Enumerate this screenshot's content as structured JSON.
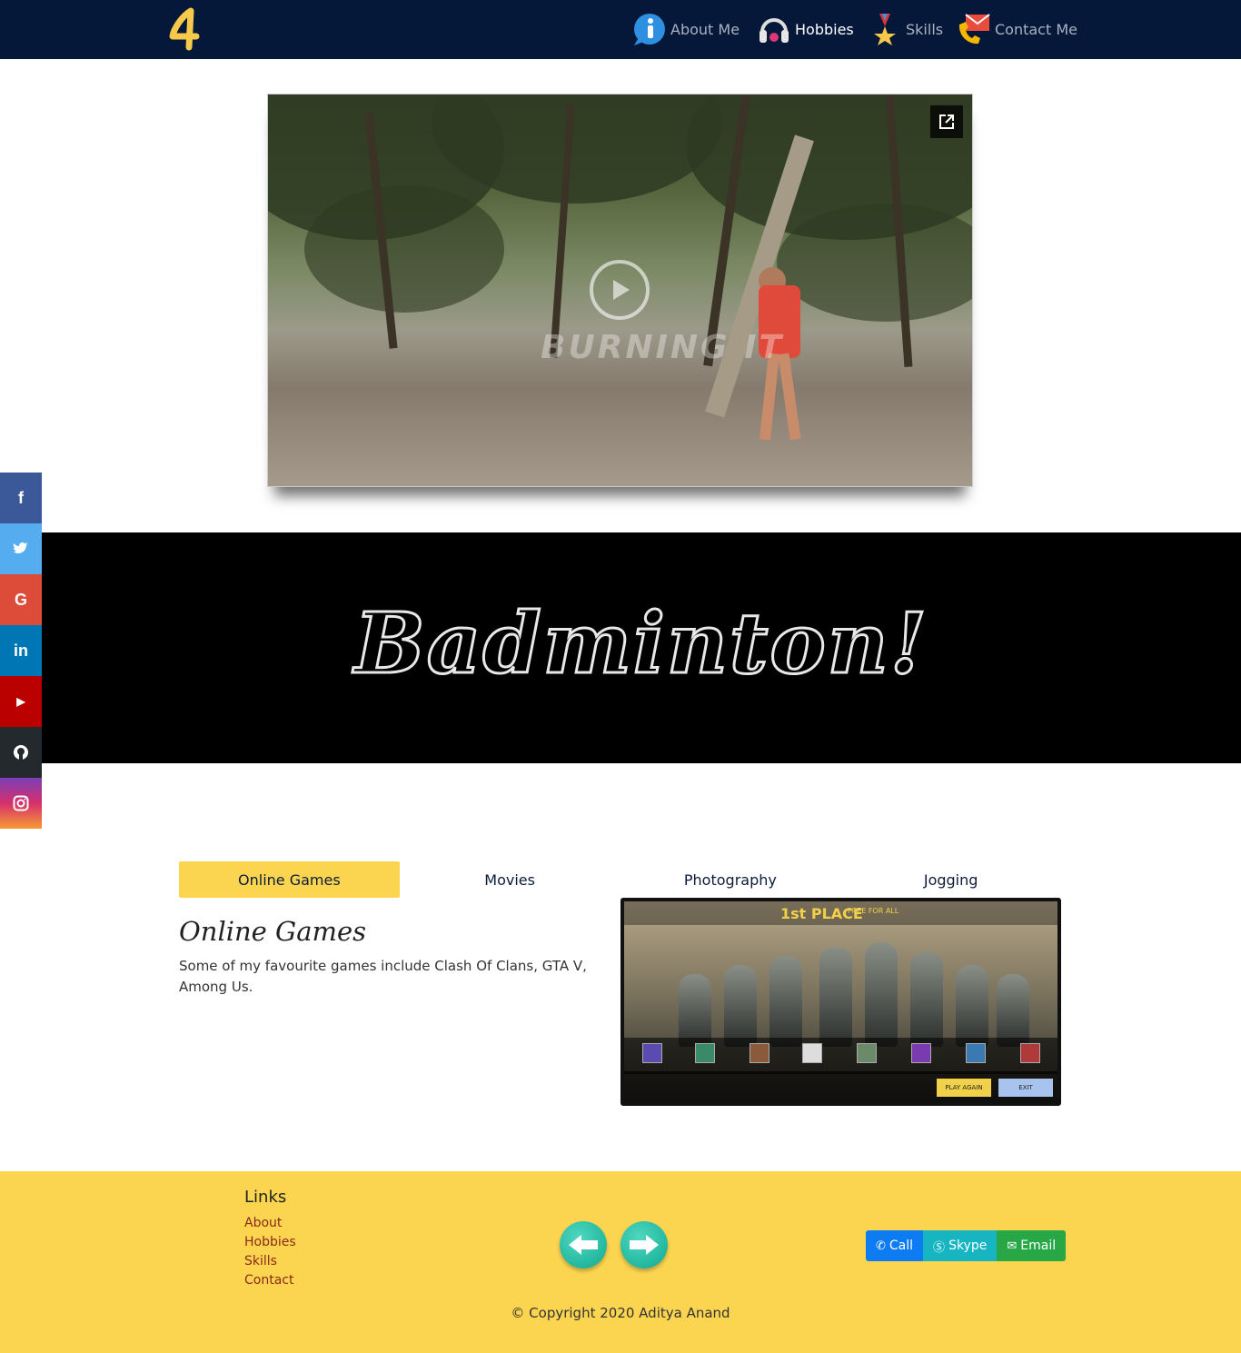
{
  "nav": {
    "logo_text": "A",
    "items": [
      {
        "label": "About Me",
        "active": false
      },
      {
        "label": "Hobbies",
        "active": true
      },
      {
        "label": "Skills",
        "active": false
      },
      {
        "label": "Contact Me",
        "active": false
      }
    ]
  },
  "video": {
    "overlay_text": "BURNING IT"
  },
  "social": [
    {
      "name": "facebook",
      "glyph": "f",
      "color": "#3b5998"
    },
    {
      "name": "twitter",
      "glyph": "t",
      "color": "#55acee"
    },
    {
      "name": "google",
      "glyph": "G",
      "color": "#dd4b39"
    },
    {
      "name": "linkedin",
      "glyph": "in",
      "color": "#0077b5"
    },
    {
      "name": "youtube",
      "glyph": "▶",
      "color": "#bb0000"
    },
    {
      "name": "github",
      "glyph": "◉",
      "color": "#24292e"
    },
    {
      "name": "instagram",
      "glyph": "◎",
      "color": "#c13584"
    }
  ],
  "banner": {
    "title": "Badminton!"
  },
  "tabs": [
    {
      "label": "Online Games",
      "active": true
    },
    {
      "label": "Movies",
      "active": false
    },
    {
      "label": "Photography",
      "active": false
    },
    {
      "label": "Jogging",
      "active": false
    }
  ],
  "content": {
    "title": "Online Games",
    "text": "Some of my favourite games include Clash Of Clans, GTA V, Among Us."
  },
  "game_screenshot": {
    "place": "1st PLACE",
    "place_sub": "FREE FOR ALL",
    "play_again": "PLAY AGAIN",
    "exit": "EXIT"
  },
  "footer": {
    "links_title": "Links",
    "links": [
      "About",
      "Hobbies",
      "Skills",
      "Contact"
    ],
    "buttons": [
      {
        "label": "Call",
        "color": "#0d7bf2"
      },
      {
        "label": "Skype",
        "color": "#17b5c2"
      },
      {
        "label": "Email",
        "color": "#27a745"
      }
    ],
    "copyright": "© Copyright 2020 Aditya Anand"
  },
  "colors": {
    "navbar": "#05183a",
    "accent_yellow": "#fcd550",
    "banner_bg": "#000000"
  }
}
